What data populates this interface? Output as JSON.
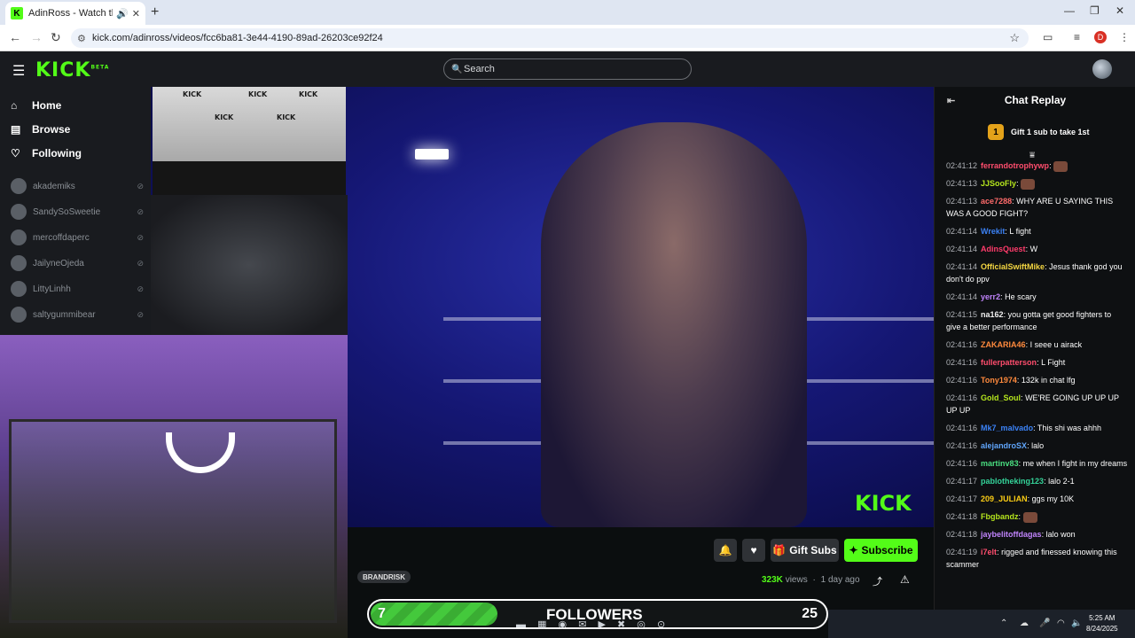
{
  "browser": {
    "tab_title": "AdinRoss - Watch the VOD",
    "new_tab": "+",
    "url": "kick.com/adinross/videos/fcc6ba81-3e44-4190-89ad-26203ce92f24",
    "profile_initial": "D"
  },
  "header": {
    "logo": "KICK",
    "logo_badge": "BETA",
    "search_placeholder": "Search"
  },
  "sidebar": {
    "nav": [
      {
        "label": "Home",
        "icon": "home-icon"
      },
      {
        "label": "Browse",
        "icon": "browse-icon"
      },
      {
        "label": "Following",
        "icon": "heart-icon"
      }
    ],
    "followed": [
      {
        "name": "akademiks"
      },
      {
        "name": "SandySoSweetie"
      },
      {
        "name": "mercoffdaperc"
      },
      {
        "name": "JailyneOjeda"
      },
      {
        "name": "LittyLinhh"
      },
      {
        "name": "saltygummibear"
      }
    ]
  },
  "video": {
    "watermark": "KICK",
    "press_text": "KICK"
  },
  "below_video": {
    "tag": "BRANDRISK",
    "views_number": "323K",
    "views_label": "views",
    "age": "1 day ago",
    "gift_subs": "Gift Subs",
    "subscribe": "Subscribe"
  },
  "chat": {
    "title": "Chat Replay",
    "gift_rank": "1",
    "gift_text": "Gift 1 sub to take 1st",
    "messages": [
      {
        "ts": "02:41:12",
        "user": "ferrandotrophywp",
        "color": "#ff4d6d",
        "text": ""
      },
      {
        "ts": "02:41:13",
        "user": "JJSooFly",
        "color": "#b5e61d",
        "text": ""
      },
      {
        "ts": "02:41:13",
        "user": "ace7288",
        "color": "#ff6b6b",
        "text": "WHY ARE U SAYING THIS WAS A GOOD FIGHT?"
      },
      {
        "ts": "02:41:14",
        "user": "Wrekit",
        "color": "#3b82f6",
        "text": "L fight"
      },
      {
        "ts": "02:41:14",
        "user": "AdinsQuest",
        "color": "#ff3b6b",
        "text": "W"
      },
      {
        "ts": "02:41:14",
        "user": "OfficialSwiftMike",
        "color": "#f5d742",
        "text": "Jesus thank god you don't do ppv"
      },
      {
        "ts": "02:41:14",
        "user": "yerr2",
        "color": "#c084fc",
        "text": "He scary"
      },
      {
        "ts": "02:41:15",
        "user": "na162",
        "color": "#f0f0f0",
        "text": "you gotta get good fighters to give a better performance"
      },
      {
        "ts": "02:41:16",
        "user": "ZAKARIA46",
        "color": "#ff8a3d",
        "text": "I seee u airack"
      },
      {
        "ts": "02:41:16",
        "user": "fullerpatterson",
        "color": "#ff4d6d",
        "text": "L Fight"
      },
      {
        "ts": "02:41:16",
        "user": "Tony1974",
        "color": "#ff8a3d",
        "text": "132k in chat lfg"
      },
      {
        "ts": "02:41:16",
        "user": "Gold_Soul",
        "color": "#b5e61d",
        "text": "WE'RE GOING UP UP UP UP UP"
      },
      {
        "ts": "02:41:16",
        "user": "Mk7_malvado",
        "color": "#3b82f6",
        "text": "This shi was ahhh"
      },
      {
        "ts": "02:41:16",
        "user": "alejandroSX",
        "color": "#60a5fa",
        "text": "lalo"
      },
      {
        "ts": "02:41:16",
        "user": "martinv83",
        "color": "#4ade80",
        "text": "me when I fight in my dreams"
      },
      {
        "ts": "02:41:17",
        "user": "pablotheking123",
        "color": "#34d399",
        "text": "lalo 2-1"
      },
      {
        "ts": "02:41:17",
        "user": "209_JULIAN",
        "color": "#facc15",
        "text": "ggs my 10K"
      },
      {
        "ts": "02:41:18",
        "user": "Fbgbandz",
        "color": "#b5e61d",
        "text": ""
      },
      {
        "ts": "02:41:18",
        "user": "jaybelitoffdagas",
        "color": "#c084fc",
        "text": "lalo won"
      },
      {
        "ts": "02:41:19",
        "user": "i7elt",
        "color": "#ff4d6d",
        "text": "rigged and finessed knowing this scammer"
      }
    ]
  },
  "followers_goal": {
    "current": "7",
    "label": "FOLLOWERS",
    "goal": "25",
    "progress_fraction": 0.28
  },
  "taskbar": {
    "time": "5:25 AM",
    "date": "8/24/2025"
  }
}
